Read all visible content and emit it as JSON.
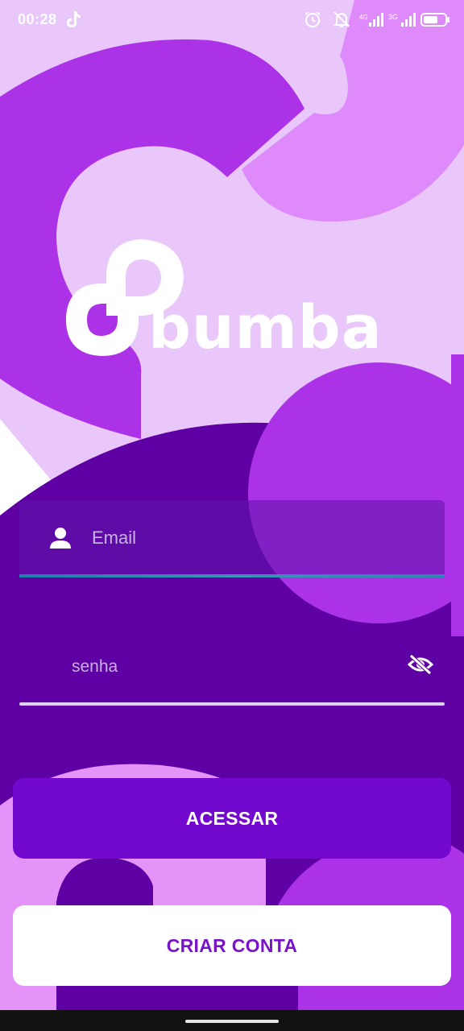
{
  "status_bar": {
    "time": "00:28",
    "network_label": "3G",
    "icons": [
      "tiktok-icon",
      "alarm-icon",
      "bell-off-icon",
      "signal-icon",
      "signal-3g-icon",
      "battery-icon"
    ]
  },
  "logo": {
    "wordmark": "bumba"
  },
  "login_form": {
    "email_placeholder": "Email",
    "password_placeholder": "senha",
    "email_icon": "person-icon",
    "password_toggle_icon": "eye-off-icon"
  },
  "actions": {
    "login_label": "ACESSAR",
    "signup_label": "CRIAR CONTA"
  },
  "colors": {
    "deep_purple": "#5e00a4",
    "primary_purple": "#7309cf",
    "violet": "#ab32e6",
    "light_lilac": "#e9c7fb",
    "field_underline": "#2b86b3"
  }
}
